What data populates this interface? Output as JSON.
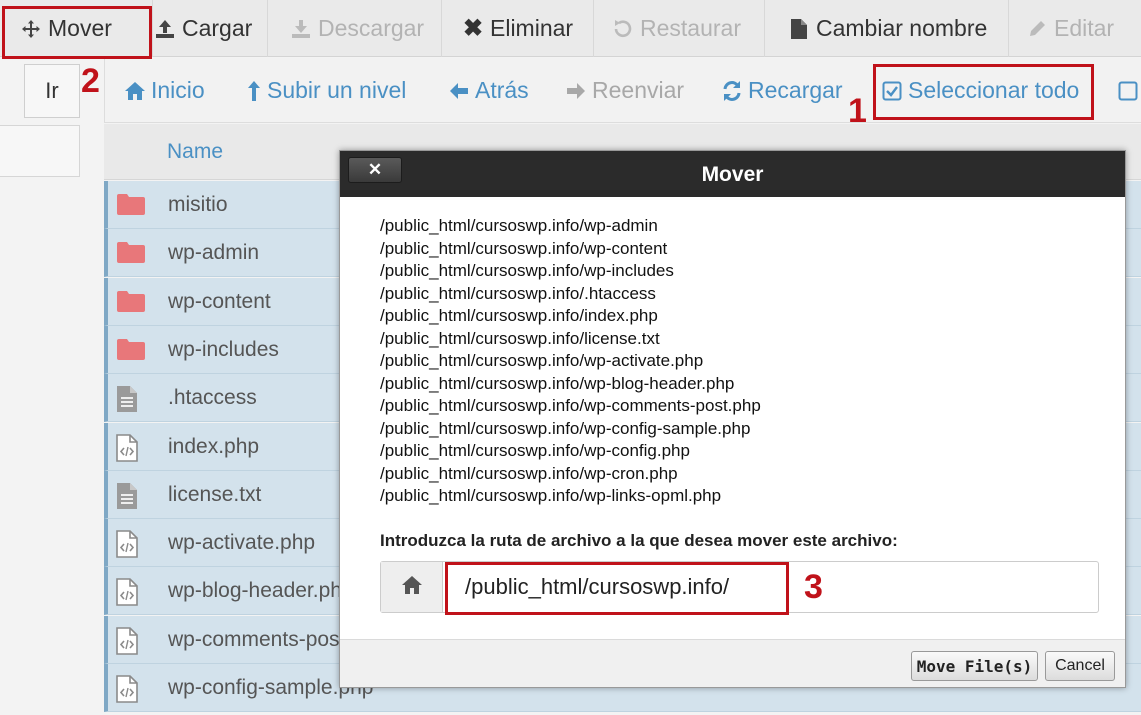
{
  "toolbar": {
    "move": "Mover",
    "upload": "Cargar",
    "download": "Descargar",
    "delete": "Eliminar",
    "restore": "Restaurar",
    "rename": "Cambiar nombre",
    "edit": "Editar"
  },
  "nav": {
    "go": "Ir",
    "home": "Inicio",
    "up_level": "Subir un nivel",
    "back": "Atrás",
    "forward": "Reenviar",
    "reload": "Recargar",
    "select_all": "Seleccionar todo"
  },
  "list": {
    "column_name": "Name",
    "files": [
      {
        "name": "misitio",
        "icon": "folder-icon"
      },
      {
        "name": "wp-admin",
        "icon": "folder-icon"
      },
      {
        "name": "wp-content",
        "icon": "folder-icon"
      },
      {
        "name": "wp-includes",
        "icon": "folder-icon"
      },
      {
        "name": ".htaccess",
        "icon": "text-file-icon"
      },
      {
        "name": "index.php",
        "icon": "code-file-icon"
      },
      {
        "name": "license.txt",
        "icon": "text-file-icon"
      },
      {
        "name": "wp-activate.php",
        "icon": "code-file-icon"
      },
      {
        "name": "wp-blog-header.php",
        "icon": "code-file-icon"
      },
      {
        "name": "wp-comments-post.php",
        "icon": "code-file-icon"
      },
      {
        "name": "wp-config-sample.php",
        "icon": "code-file-icon"
      }
    ]
  },
  "modal": {
    "title": "Mover",
    "close": "✕",
    "paths": [
      "/public_html/cursoswp.info/wp-admin",
      "/public_html/cursoswp.info/wp-content",
      "/public_html/cursoswp.info/wp-includes",
      "/public_html/cursoswp.info/.htaccess",
      "/public_html/cursoswp.info/index.php",
      "/public_html/cursoswp.info/license.txt",
      "/public_html/cursoswp.info/wp-activate.php",
      "/public_html/cursoswp.info/wp-blog-header.php",
      "/public_html/cursoswp.info/wp-comments-post.php",
      "/public_html/cursoswp.info/wp-config-sample.php",
      "/public_html/cursoswp.info/wp-config.php",
      "/public_html/cursoswp.info/wp-cron.php",
      "/public_html/cursoswp.info/wp-links-opml.php"
    ],
    "prompt": "Introduzca la ruta de archivo a la que desea mover este archivo:",
    "path_value": "/public_html/cursoswp.info/",
    "move_button": "Move File(s)",
    "cancel_button": "Cancel"
  },
  "annotations": {
    "step1": "1",
    "step2": "2",
    "step3": "3"
  },
  "colors": {
    "highlight": "#c0121a",
    "link_blue": "#4a90c4",
    "row_selected": "#d3e2ec",
    "folder": "#e8777a"
  }
}
